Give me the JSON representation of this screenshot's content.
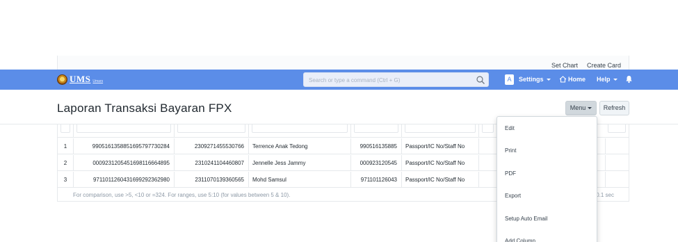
{
  "top_strip": {
    "set_chart": "Set Chart",
    "create_card": "Create Card"
  },
  "navbar": {
    "logo_text": "UMS",
    "logo_tag": "Umars",
    "search_placeholder": "Search or type a command (Ctrl + G)",
    "avatar_letter": "A",
    "settings": "Settings",
    "home": "Home",
    "help": "Help",
    "brand_color": "#5b8de8"
  },
  "page": {
    "title": "Laporan Transaksi Bayaran FPX",
    "menu_button": "Menu",
    "refresh_button": "Refresh"
  },
  "table": {
    "rows": [
      {
        "idx": "1",
        "c1": "990516135885169579773028​4",
        "c2": "2309271455530766",
        "c3": "Terrence Anak Tedong",
        "c4": "990516135885",
        "c5": "Passport/IC No/Staff No"
      },
      {
        "idx": "2",
        "c1": "0009231205451698116664895",
        "c2": "2310241104460807",
        "c3": "Jennelle Jess Jammy",
        "c4": "000923120545",
        "c5": "Passport/IC No/Staff No"
      },
      {
        "idx": "3",
        "c1": "9711011260431699292362980",
        "c2": "2311070139360565",
        "c3": "Mohd Samsul",
        "c4": "971101126043",
        "c5": "Passport/IC No/Staff No"
      }
    ],
    "footer_note": "For comparison, use >5, <10 or =324. For ranges, use 5:10 (for values between 5 & 10).",
    "footer_time": "0.1 sec"
  },
  "menu": {
    "items": [
      "Edit",
      "Print",
      "PDF",
      "Export",
      "Setup Auto Email",
      "Add Column"
    ]
  }
}
